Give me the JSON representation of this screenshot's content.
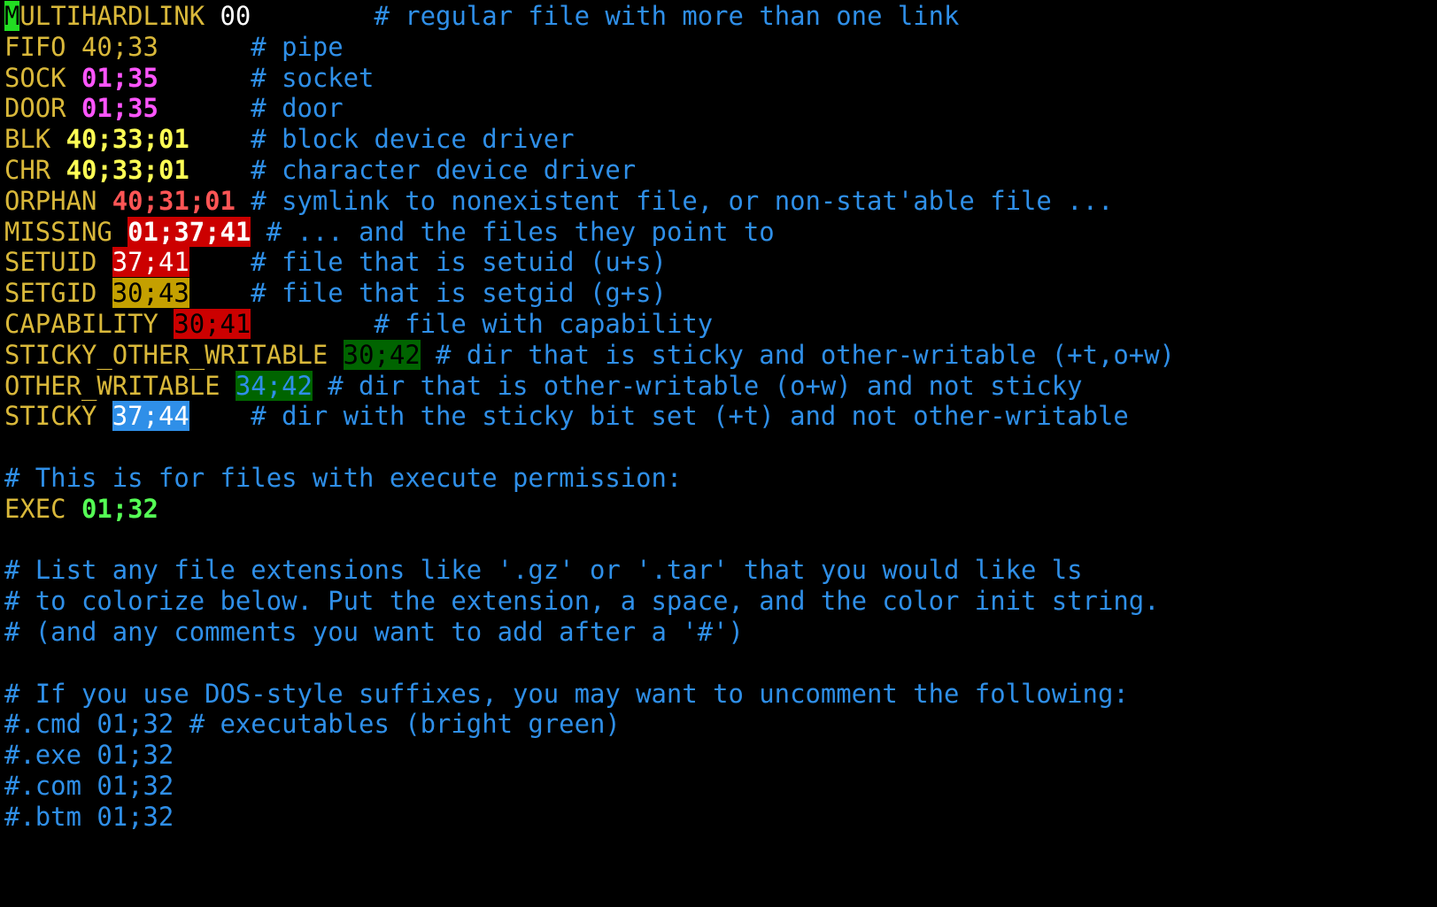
{
  "colors": {
    "background": "#000000",
    "keyword": "#d9b83a",
    "comment": "#2f8fe8",
    "cursor_bg": "#22dd22"
  },
  "cursor": {
    "char": "M"
  },
  "lines": [
    {
      "segments": [
        {
          "text": "ULTIHARDLINK ",
          "fg": "#d9b83a"
        },
        {
          "text": "00",
          "fg": "#ffffff"
        },
        {
          "text": "        # regular file with more than one link",
          "fg": "#2f8fe8"
        }
      ]
    },
    {
      "segments": [
        {
          "text": "FIFO ",
          "fg": "#d9b83a"
        },
        {
          "text": "40;33",
          "fg": "#d9b83a"
        },
        {
          "text": "      # pipe",
          "fg": "#2f8fe8"
        }
      ]
    },
    {
      "segments": [
        {
          "text": "SOCK ",
          "fg": "#d9b83a"
        },
        {
          "text": "01;35",
          "fg": "#ff55ff",
          "bold": true
        },
        {
          "text": "      # socket",
          "fg": "#2f8fe8"
        }
      ]
    },
    {
      "segments": [
        {
          "text": "DOOR ",
          "fg": "#d9b83a"
        },
        {
          "text": "01;35",
          "fg": "#ff55ff",
          "bold": true
        },
        {
          "text": "      # door",
          "fg": "#2f8fe8"
        }
      ]
    },
    {
      "segments": [
        {
          "text": "BLK ",
          "fg": "#d9b83a"
        },
        {
          "text": "40;33;01",
          "fg": "#ffff55",
          "bold": true
        },
        {
          "text": "    # block device driver",
          "fg": "#2f8fe8"
        }
      ]
    },
    {
      "segments": [
        {
          "text": "CHR ",
          "fg": "#d9b83a"
        },
        {
          "text": "40;33;01",
          "fg": "#ffff55",
          "bold": true
        },
        {
          "text": "    # character device driver",
          "fg": "#2f8fe8"
        }
      ]
    },
    {
      "segments": [
        {
          "text": "ORPHAN ",
          "fg": "#d9b83a"
        },
        {
          "text": "40;31;01",
          "fg": "#ff5555",
          "bold": true
        },
        {
          "text": " # symlink to nonexistent file, or non-stat'able file ...",
          "fg": "#2f8fe8"
        }
      ]
    },
    {
      "segments": [
        {
          "text": "MISSING ",
          "fg": "#d9b83a"
        },
        {
          "text": "01;37;41",
          "fg": "#ffffff",
          "bg": "#cc0000",
          "bold": true
        },
        {
          "text": " # ... and the files they point to",
          "fg": "#2f8fe8"
        }
      ]
    },
    {
      "segments": [
        {
          "text": "SETUID ",
          "fg": "#d9b83a"
        },
        {
          "text": "37;41",
          "fg": "#ffffff",
          "bg": "#cc0000"
        },
        {
          "text": "    # file that is setuid (u+s)",
          "fg": "#2f8fe8"
        }
      ]
    },
    {
      "segments": [
        {
          "text": "SETGID ",
          "fg": "#d9b83a"
        },
        {
          "text": "30;43",
          "fg": "#000000",
          "bg": "#c4a000"
        },
        {
          "text": "    # file that is setgid (g+s)",
          "fg": "#2f8fe8"
        }
      ]
    },
    {
      "segments": [
        {
          "text": "CAPABILITY ",
          "fg": "#d9b83a"
        },
        {
          "text": "30;41",
          "fg": "#000000",
          "bg": "#cc0000"
        },
        {
          "text": "        # file with capability",
          "fg": "#2f8fe8"
        }
      ]
    },
    {
      "segments": [
        {
          "text": "STICKY_OTHER_WRITABLE ",
          "fg": "#d9b83a"
        },
        {
          "text": "30;42",
          "fg": "#000000",
          "bg": "#006400"
        },
        {
          "text": " # dir that is sticky and other-writable (+t,o+w)",
          "fg": "#2f8fe8"
        }
      ]
    },
    {
      "segments": [
        {
          "text": "OTHER_WRITABLE ",
          "fg": "#d9b83a"
        },
        {
          "text": "34;42",
          "fg": "#2f8fe8",
          "bg": "#006400"
        },
        {
          "text": " # dir that is other-writable (o+w) and not sticky",
          "fg": "#2f8fe8"
        }
      ]
    },
    {
      "segments": [
        {
          "text": "STICKY ",
          "fg": "#d9b83a"
        },
        {
          "text": "37;44",
          "fg": "#ffffff",
          "bg": "#2f8fe8"
        },
        {
          "text": "    # dir with the sticky bit set (+t) and not other-writable",
          "fg": "#2f8fe8"
        }
      ]
    },
    {
      "segments": []
    },
    {
      "segments": [
        {
          "text": "# This is for files with execute permission:",
          "fg": "#2f8fe8"
        }
      ]
    },
    {
      "segments": [
        {
          "text": "EXEC ",
          "fg": "#d9b83a"
        },
        {
          "text": "01;32",
          "fg": "#55ff55",
          "bold": true
        }
      ]
    },
    {
      "segments": []
    },
    {
      "segments": [
        {
          "text": "# List any file extensions like '.gz' or '.tar' that you would like ls",
          "fg": "#2f8fe8"
        }
      ]
    },
    {
      "segments": [
        {
          "text": "# to colorize below. Put the extension, a space, and the color init string.",
          "fg": "#2f8fe8"
        }
      ]
    },
    {
      "segments": [
        {
          "text": "# (and any comments you want to add after a '#')",
          "fg": "#2f8fe8"
        }
      ]
    },
    {
      "segments": []
    },
    {
      "segments": [
        {
          "text": "# If you use DOS-style suffixes, you may want to uncomment the following:",
          "fg": "#2f8fe8"
        }
      ]
    },
    {
      "segments": [
        {
          "text": "#.cmd 01;32 # executables (bright green)",
          "fg": "#2f8fe8"
        }
      ]
    },
    {
      "segments": [
        {
          "text": "#.exe 01;32",
          "fg": "#2f8fe8"
        }
      ]
    },
    {
      "segments": [
        {
          "text": "#.com 01;32",
          "fg": "#2f8fe8"
        }
      ]
    },
    {
      "segments": [
        {
          "text": "#.btm 01;32",
          "fg": "#2f8fe8"
        }
      ]
    }
  ]
}
